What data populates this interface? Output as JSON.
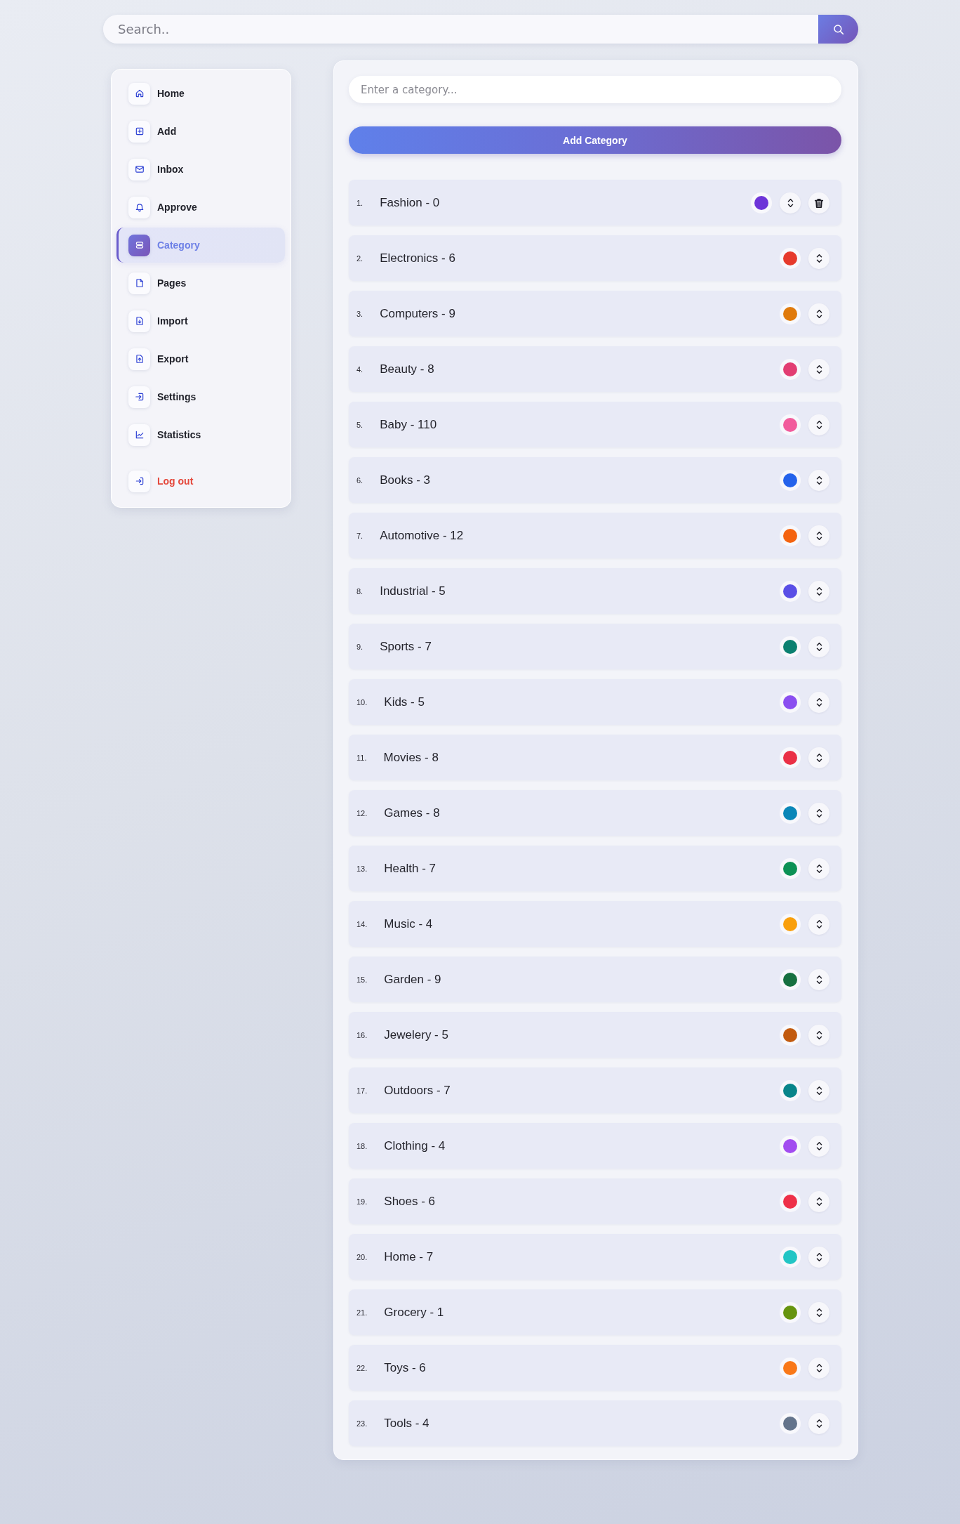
{
  "search": {
    "placeholder": "Search.."
  },
  "sidebar": {
    "items": [
      {
        "label": "Home",
        "kind": "nav",
        "selected": false
      },
      {
        "label": "Add",
        "kind": "nav",
        "selected": false
      },
      {
        "label": "Inbox",
        "kind": "nav",
        "selected": false
      },
      {
        "label": "Approve",
        "kind": "nav",
        "selected": false
      },
      {
        "label": "Category",
        "kind": "nav",
        "selected": true
      },
      {
        "label": "Pages",
        "kind": "nav",
        "selected": false
      },
      {
        "label": "Import",
        "kind": "nav",
        "selected": false
      },
      {
        "label": "Export",
        "kind": "nav",
        "selected": false
      },
      {
        "label": "Settings",
        "kind": "nav",
        "selected": false
      },
      {
        "label": "Statistics",
        "kind": "nav",
        "selected": false
      },
      {
        "label": "Log out",
        "kind": "logout",
        "selected": false
      }
    ]
  },
  "category_form": {
    "placeholder": "Enter a category...",
    "button": "Add Category"
  },
  "categories": [
    {
      "number": "1.",
      "label": "Fashion - 0",
      "color": "#6d34d8",
      "delete_button": true
    },
    {
      "number": "2.",
      "label": "Electronics - 6",
      "color": "#e63a2c",
      "delete_button": false
    },
    {
      "number": "3.",
      "label": "Computers - 9",
      "color": "#e07a0b",
      "delete_button": false
    },
    {
      "number": "4.",
      "label": "Beauty - 8",
      "color": "#e23d72",
      "delete_button": false
    },
    {
      "number": "5.",
      "label": "Baby - 110",
      "color": "#f25c9c",
      "delete_button": false
    },
    {
      "number": "6.",
      "label": "Books - 3",
      "color": "#2563eb",
      "delete_button": false
    },
    {
      "number": "7.",
      "label": "Automotive - 12",
      "color": "#f4630f",
      "delete_button": false
    },
    {
      "number": "8.",
      "label": "Industrial - 5",
      "color": "#5a4fe6",
      "delete_button": false
    },
    {
      "number": "9.",
      "label": "Sports - 7",
      "color": "#0b8070",
      "delete_button": false
    },
    {
      "number": "10.",
      "label": "Kids - 5",
      "color": "#8b4ff0",
      "delete_button": false
    },
    {
      "number": "11.",
      "label": "Movies - 8",
      "color": "#ea3046",
      "delete_button": false
    },
    {
      "number": "12.",
      "label": "Games - 8",
      "color": "#0a87b8",
      "delete_button": false
    },
    {
      "number": "13.",
      "label": "Health - 7",
      "color": "#0c9155",
      "delete_button": false
    },
    {
      "number": "14.",
      "label": "Music - 4",
      "color": "#f99f0b",
      "delete_button": false
    },
    {
      "number": "15.",
      "label": "Garden - 9",
      "color": "#177040",
      "delete_button": false
    },
    {
      "number": "16.",
      "label": "Jewelery - 5",
      "color": "#c25a0e",
      "delete_button": false
    },
    {
      "number": "17.",
      "label": "Outdoors - 7",
      "color": "#08858a",
      "delete_button": false
    },
    {
      "number": "18.",
      "label": "Clothing - 4",
      "color": "#a24cf0",
      "delete_button": false
    },
    {
      "number": "19.",
      "label": "Shoes - 6",
      "color": "#ee3048",
      "delete_button": false
    },
    {
      "number": "20.",
      "label": "Home - 7",
      "color": "#22c5c5",
      "delete_button": false
    },
    {
      "number": "21.",
      "label": "Grocery - 1",
      "color": "#66940f",
      "delete_button": false
    },
    {
      "number": "22.",
      "label": "Toys - 6",
      "color": "#f97818",
      "delete_button": false
    },
    {
      "number": "23.",
      "label": "Tools - 4",
      "color": "#64748b",
      "delete_button": false
    }
  ]
}
